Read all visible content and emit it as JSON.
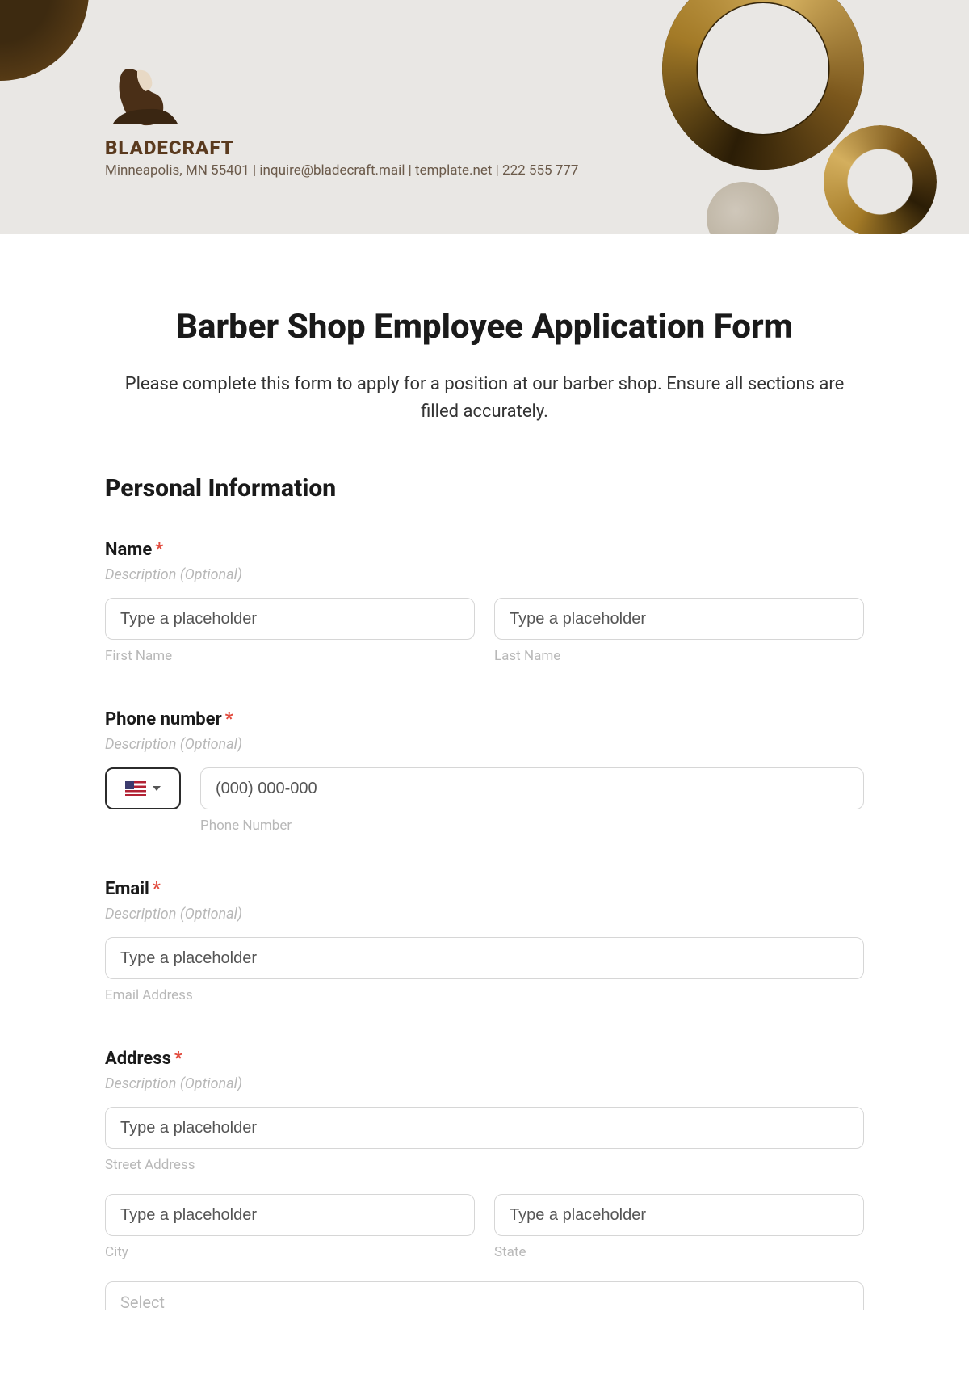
{
  "header": {
    "brand_name": "BLADECRAFT",
    "brand_sub": "Minneapolis, MN 55401 | inquire@bladecraft.mail | template.net | 222 555 777"
  },
  "form": {
    "title": "Barber Shop Employee Application Form",
    "intro": "Please complete this form to apply for a position at our barber shop. Ensure all sections are filled accurately.",
    "section_personal": "Personal Information",
    "desc_optional": "Description (Optional)",
    "name": {
      "label": "Name",
      "first_placeholder": "Type a placeholder",
      "first_sub": "First Name",
      "last_placeholder": "Type a placeholder",
      "last_sub": "Last Name"
    },
    "phone": {
      "label": "Phone number",
      "placeholder": "(000) 000-000",
      "sub": "Phone Number"
    },
    "email": {
      "label": "Email",
      "placeholder": "Type a placeholder",
      "sub": "Email Address"
    },
    "address": {
      "label": "Address",
      "street_placeholder": "Type a placeholder",
      "street_sub": "Street Address",
      "city_placeholder": "Type a placeholder",
      "city_sub": "City",
      "state_placeholder": "Type a placeholder",
      "state_sub": "State",
      "select_placeholder": "Select"
    }
  }
}
